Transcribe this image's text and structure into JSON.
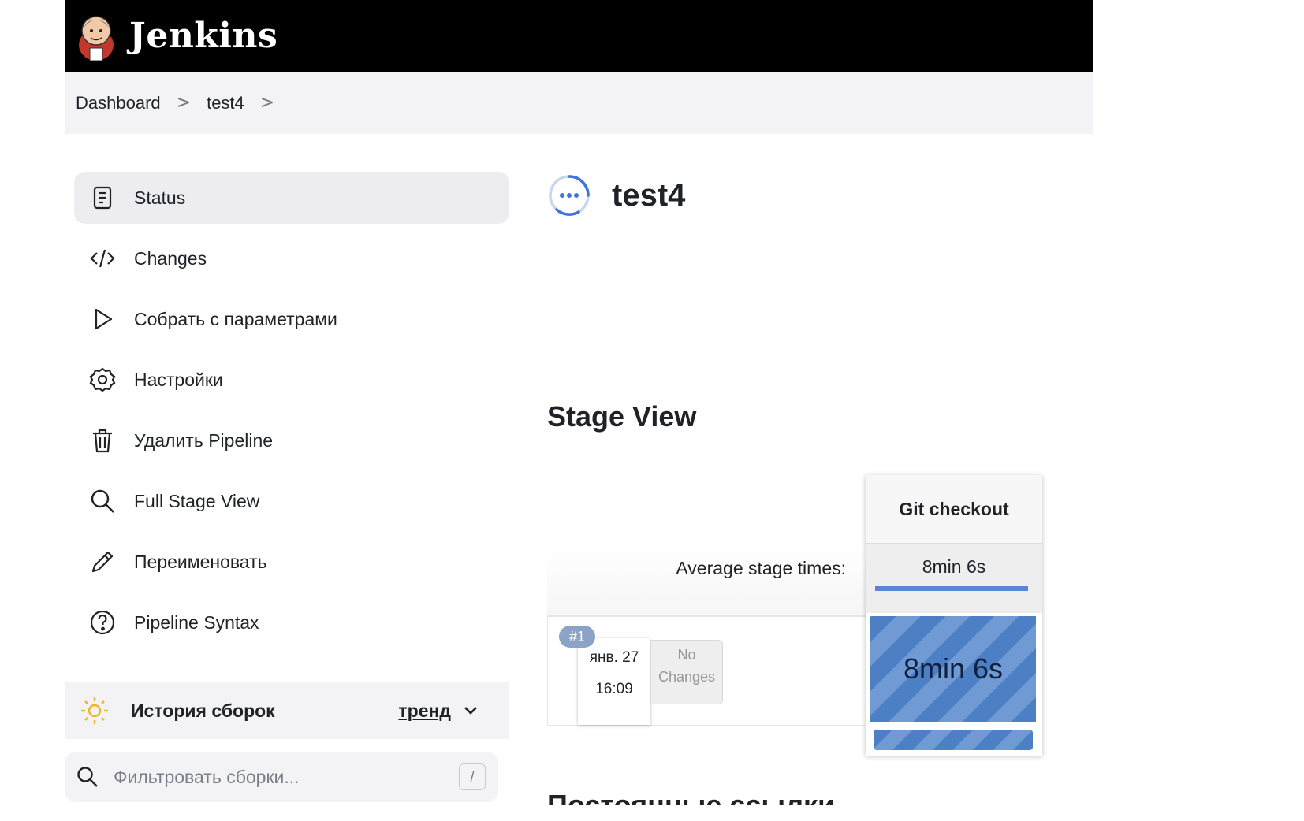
{
  "header": {
    "brand": "Jenkins",
    "logo": "jenkins-butler-logo"
  },
  "breadcrumb": {
    "items": [
      "Dashboard",
      "test4"
    ],
    "separator": ">"
  },
  "sidebar": {
    "items": [
      {
        "label": "Status",
        "icon": "document-icon",
        "active": true
      },
      {
        "label": "Changes",
        "icon": "code-icon"
      },
      {
        "label": "Собрать с параметрами",
        "icon": "play-icon"
      },
      {
        "label": "Настройки",
        "icon": "gear-icon"
      },
      {
        "label": "Удалить Pipeline",
        "icon": "trash-icon"
      },
      {
        "label": "Full Stage View",
        "icon": "search-icon"
      },
      {
        "label": "Переименовать",
        "icon": "pencil-icon"
      },
      {
        "label": "Pipeline Syntax",
        "icon": "question-icon"
      }
    ]
  },
  "build_history": {
    "title": "История сборок",
    "trend_label": "тренд",
    "filter_placeholder": "Фильтровать сборки...",
    "shortcut": "/"
  },
  "main": {
    "title": "test4",
    "stage_view_heading": "Stage View",
    "avg_label": "Average stage times:",
    "stage": {
      "name": "Git checkout",
      "avg_time": "8min 6s",
      "cell_time": "8min 6s"
    },
    "build": {
      "number": "#1",
      "date": "янв. 27",
      "time": "16:09",
      "changes": "No Changes"
    },
    "permalinks_heading": "Постоянные ссылки"
  },
  "colors": {
    "accent": "#5b83d6",
    "stage_success": "#4d7fc4",
    "header_bg": "#000000"
  }
}
